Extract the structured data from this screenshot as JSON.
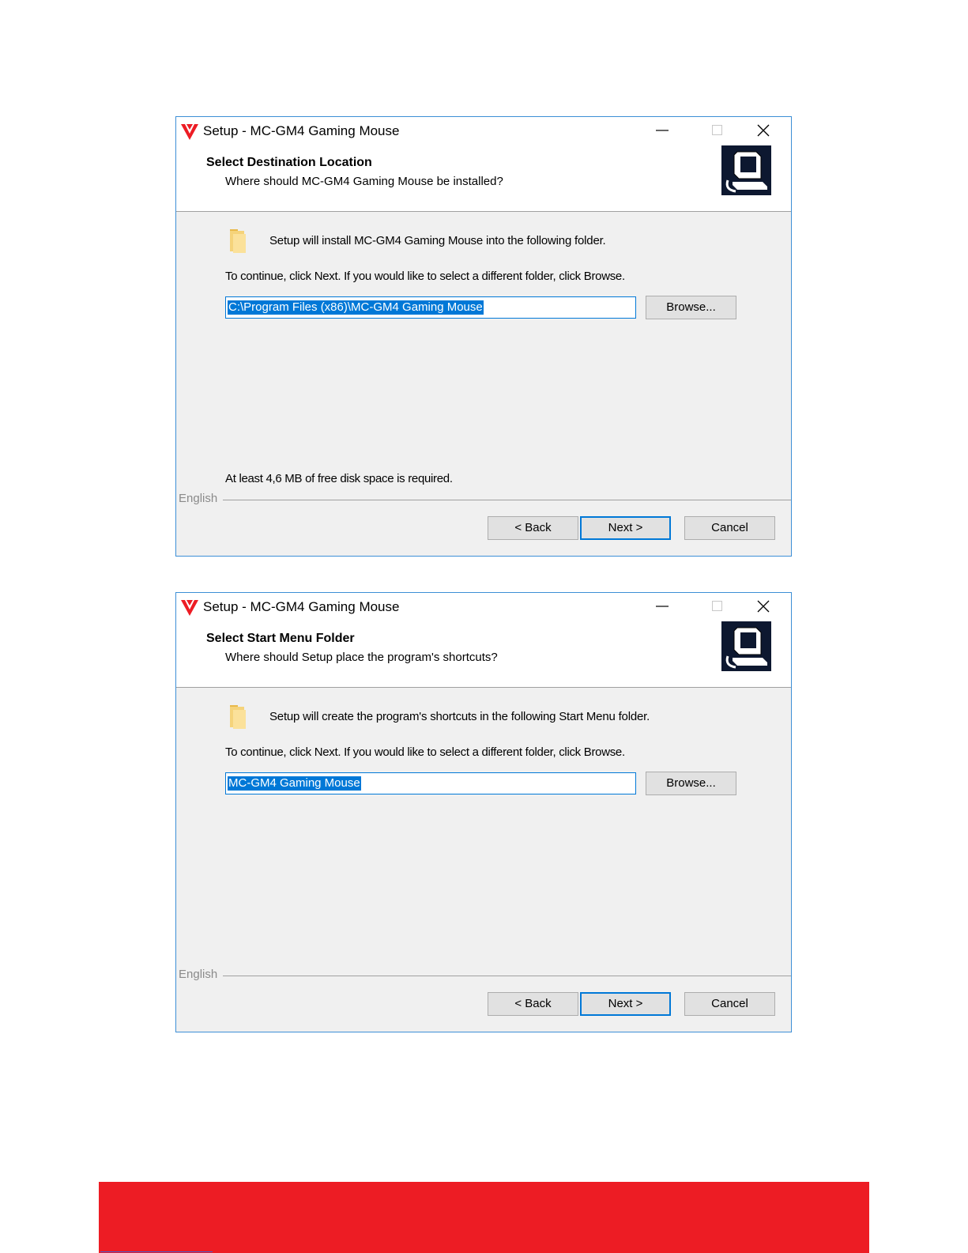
{
  "dialogs": [
    {
      "title": "Setup - MC-GM4 Gaming Mouse",
      "header_title": "Select Destination Location",
      "header_subtitle": "Where should MC-GM4 Gaming Mouse be installed?",
      "intro": "Setup will install MC-GM4 Gaming Mouse into the following folder.",
      "instruction": "To continue, click Next. If you would like to select a different folder, click Browse.",
      "input_value": "C:\\Program Files (x86)\\MC-GM4 Gaming Mouse",
      "browse_label": "Browse...",
      "space_text": "At least 4,6 MB of free disk space is required.",
      "language": "English",
      "back_label": "< Back",
      "next_label": "Next >",
      "cancel_label": "Cancel"
    },
    {
      "title": "Setup - MC-GM4 Gaming Mouse",
      "header_title": "Select Start Menu Folder",
      "header_subtitle": "Where should Setup place the program's shortcuts?",
      "intro": "Setup will create the program's shortcuts in the following Start Menu folder.",
      "instruction": "To continue, click Next. If you would like to select a different folder, click Browse.",
      "input_value": "MC-GM4 Gaming Mouse",
      "browse_label": "Browse...",
      "language": "English",
      "back_label": "< Back",
      "next_label": "Next >",
      "cancel_label": "Cancel"
    }
  ],
  "colors": {
    "accent": "#0078d7",
    "brand_red": "#ed1c24",
    "window_border": "#3d8fd6"
  }
}
